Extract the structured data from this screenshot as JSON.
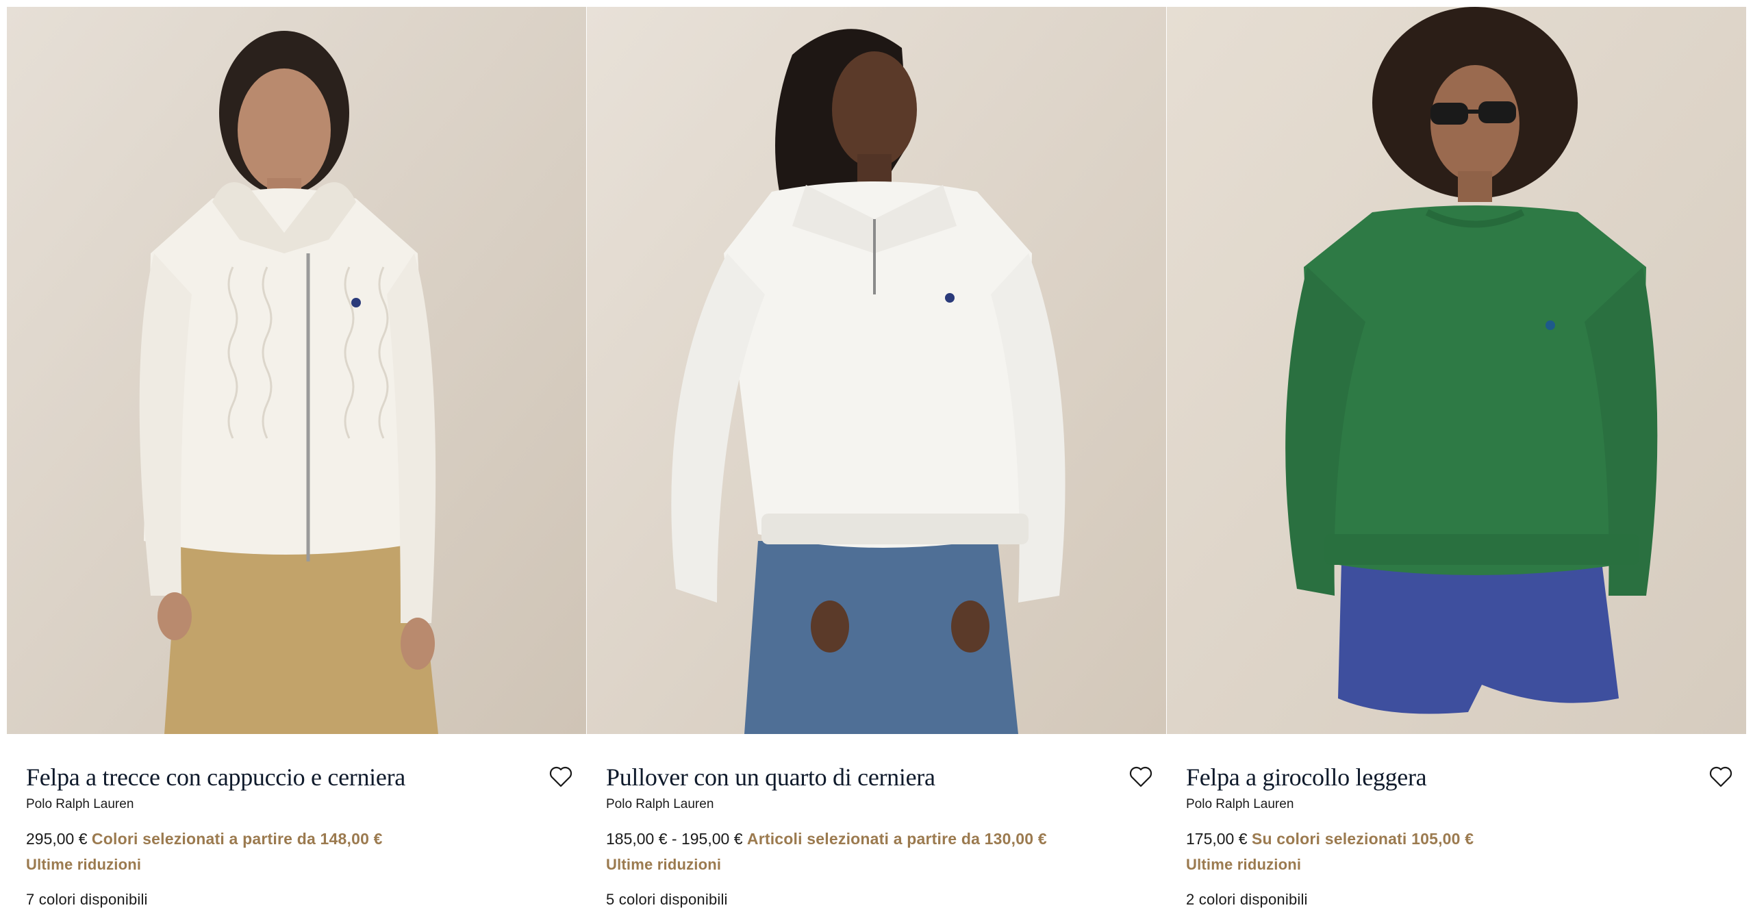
{
  "products": [
    {
      "title": "Felpa a trecce con cappuccio e cerniera",
      "brand": "Polo Ralph Lauren",
      "price": "295,00 €",
      "promo": "Colori selezionati a partire da 148,00 €",
      "reduction": "Ultime riduzioni",
      "colors_available": "7 colori disponibili",
      "garment_color": "#f4f1ea",
      "pants_color": "#c2a36a"
    },
    {
      "title": "Pullover con un quarto di cerniera",
      "brand": "Polo Ralph Lauren",
      "price": "185,00 € - 195,00 €",
      "promo": "Articoli selezionati a partire da 130,00 €",
      "reduction": "Ultime riduzioni",
      "colors_available": "5 colori disponibili",
      "garment_color": "#f5f4f0",
      "pants_color": "#4f6f96"
    },
    {
      "title": "Felpa a girocollo leggera",
      "brand": "Polo Ralph Lauren",
      "price": "175,00 €",
      "promo": "Su colori selezionati 105,00 €",
      "reduction": "Ultime riduzioni",
      "colors_available": "2 colori disponibili",
      "garment_color": "#2e7a45",
      "pants_color": "#3e4f9e"
    }
  ],
  "colors": {
    "promo": "#9b7a4f",
    "title": "#0f1a2b",
    "photo_background": "#ddd5ca"
  },
  "icons": {
    "wishlist": "heart-outline-icon"
  }
}
